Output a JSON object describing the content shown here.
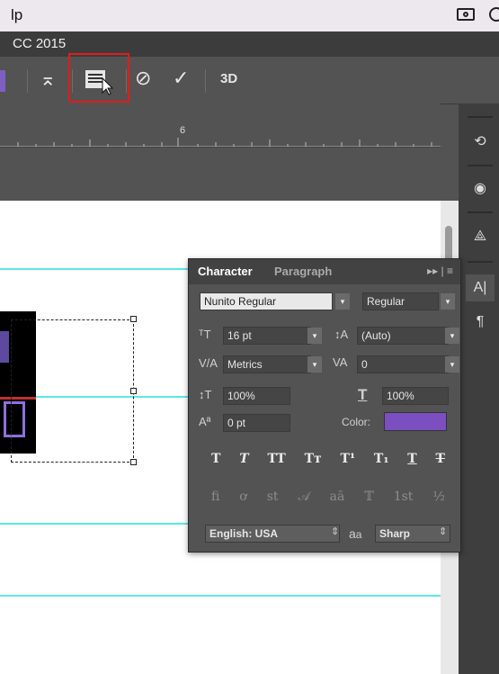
{
  "menubar": {
    "label": "lp"
  },
  "window": {
    "title": "CC 2015"
  },
  "optionsbar": {
    "tools": [
      {
        "name": "warp-text-icon",
        "glyph": "⌅"
      },
      {
        "name": "character-paragraph-panel-icon",
        "glyph": "▤"
      },
      {
        "name": "cancel-icon",
        "glyph": "⊘"
      },
      {
        "name": "commit-icon",
        "glyph": "✓"
      },
      {
        "name": "3d-label",
        "glyph": "3D"
      }
    ]
  },
  "ruler": {
    "tick_label": "6"
  },
  "panel": {
    "tabs": [
      {
        "label": "Character"
      },
      {
        "label": "Paragraph"
      }
    ],
    "menu_glyph": "▸▸ | ≡",
    "font_family": "Nunito Regular",
    "font_style": "Regular",
    "font_size": "16 pt",
    "leading": "(Auto)",
    "kerning": "Metrics",
    "tracking": "0",
    "vertical_scale": "100%",
    "horizontal_scale": "100%",
    "baseline_shift": "0 pt",
    "color_label": "Color:",
    "color_value": "#7b4fc0",
    "type_buttons": [
      "T",
      "T",
      "TT",
      "Tт",
      "T¹",
      "T₁",
      "T",
      "T"
    ],
    "opentype_buttons": [
      "fi",
      "ơ",
      "st",
      "𝒜",
      "aā",
      "𝕋",
      "1st",
      "½"
    ],
    "language": "English: USA",
    "aa_label": "a",
    "aa_sub": "a",
    "antialias": "Sharp"
  },
  "dock": {
    "items": [
      {
        "name": "history-icon",
        "glyph": "⟲"
      },
      {
        "name": "properties-icon",
        "glyph": "◉"
      },
      {
        "name": "paths-icon",
        "glyph": "⟁"
      },
      {
        "name": "character-icon",
        "glyph": "A|"
      },
      {
        "name": "paragraph-icon",
        "glyph": "¶"
      }
    ]
  }
}
